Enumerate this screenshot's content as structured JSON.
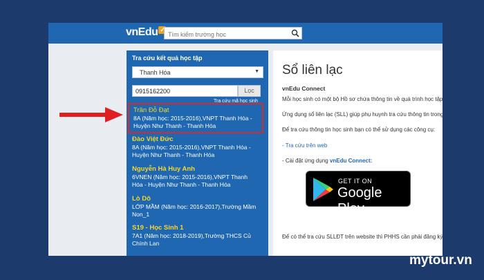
{
  "header": {
    "logo_text": "vnEdu",
    "logo_badge": "✓",
    "search_placeholder": "Tìm kiếm trường học"
  },
  "left_panel": {
    "title": "Tra cứu kết quả học tập",
    "province_select": "Thanh Hóa",
    "phone_value": "0915162200",
    "filter_label": "Lọc",
    "lookup_code_link": "Tra cứu mã học sinh",
    "results": [
      {
        "name": "Trần Đỗ Đạt",
        "info": "8A (Năm học: 2015-2016),VNPT Thanh Hóa - Huyện Như Thanh - Thanh Hóa"
      },
      {
        "name": "Đào Việt Đức",
        "info": "8A (Năm học: 2015-2016),VNPT Thanh Hóa - Huyện Như Thanh - Thanh Hóa"
      },
      {
        "name": "Nguyễn Hà Huy Anh",
        "info": "6VNEN (Năm học: 2015-2016),VNPT Thanh Hóa - Huyện Như Thanh - Thanh Hóa"
      },
      {
        "name": "Lò Dô",
        "info": "LỚP MẦM (Năm học: 2016-2017),Trường Mầm Non_1"
      },
      {
        "name": "S19 - Học Sinh 1",
        "info": "7A1 (Năm học: 2018-2019),Trường THCS Củ Chính Lan"
      }
    ]
  },
  "right_panel": {
    "title": "Sổ liên lạc",
    "subtitle": "vnEdu Connect",
    "p1": "Mỗi học sinh có một bộ Hồ sơ chứa thông tin về quá trình học tập",
    "p2": "Ứng dụng sổ liên lạc (SLL) giúp phụ huynh tra cứu thông tin trong",
    "p3": "Để tra cứu thông tin học sinh bạn có thể sử dụng các công cụ:",
    "link1": "- Tra cứu trên web",
    "app_prefix": "- Cài đặt ứng dụng ",
    "app_name": "vnEdu Connect:",
    "gplay_small": "GET IT ON",
    "gplay_big": "Google Play",
    "p_bottom": "Để có thể tra cứu SLLĐT trên website thì PHHS cần phải đăng ký"
  },
  "watermark": "mytour.vn",
  "colors": {
    "page_bg": "#1c3a6b",
    "topbar": "#1f67b1",
    "panel_blue": "#1f67b1",
    "name_yellow": "#f3d72e",
    "highlight_red": "#d72b2b"
  }
}
